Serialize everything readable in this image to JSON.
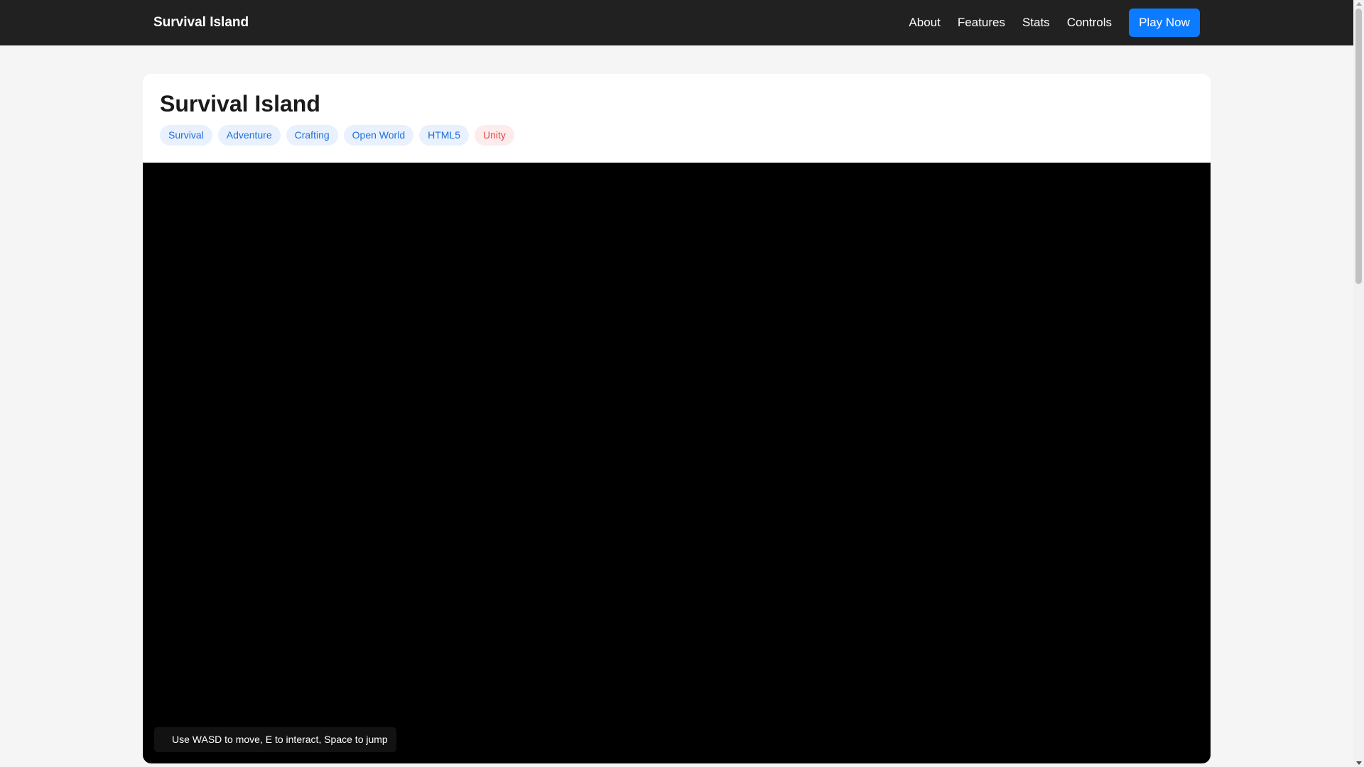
{
  "navbar": {
    "brand": "Survival Island",
    "links": [
      "About",
      "Features",
      "Stats",
      "Controls"
    ],
    "cta": "Play Now"
  },
  "game": {
    "title": "Survival Island",
    "tags": [
      "Survival",
      "Adventure",
      "Crafting",
      "Open World",
      "HTML5"
    ],
    "engine_tag": "Unity",
    "controls_hint": "Use WASD to move, E to interact, Space to jump"
  },
  "colors": {
    "navbar_bg": "#212121",
    "accent": "#0d7bff",
    "tag_bg": "#e8f1fd",
    "tag_text": "#1e6fd9",
    "engine_tag_bg": "#fdecec",
    "engine_tag_text": "#e5484d",
    "game_bg": "#000000"
  }
}
